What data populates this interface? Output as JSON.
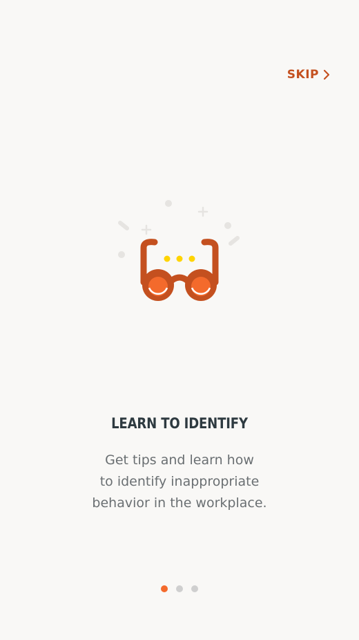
{
  "header": {
    "skip_label": "SKIP"
  },
  "illustration": {
    "icon": "glasses-icon",
    "accent_color": "#c4501f",
    "lens_color": "#f46a2c",
    "dots_color": "#ffd400"
  },
  "content": {
    "title": "LEARN TO IDENTIFY",
    "description_lines": [
      "Get tips and learn how",
      "to identify inappropriate",
      "behavior in the workplace."
    ]
  },
  "pagination": {
    "total": 3,
    "current": 1,
    "active_color": "#f46a2c",
    "inactive_color": "#cfcfcf"
  }
}
